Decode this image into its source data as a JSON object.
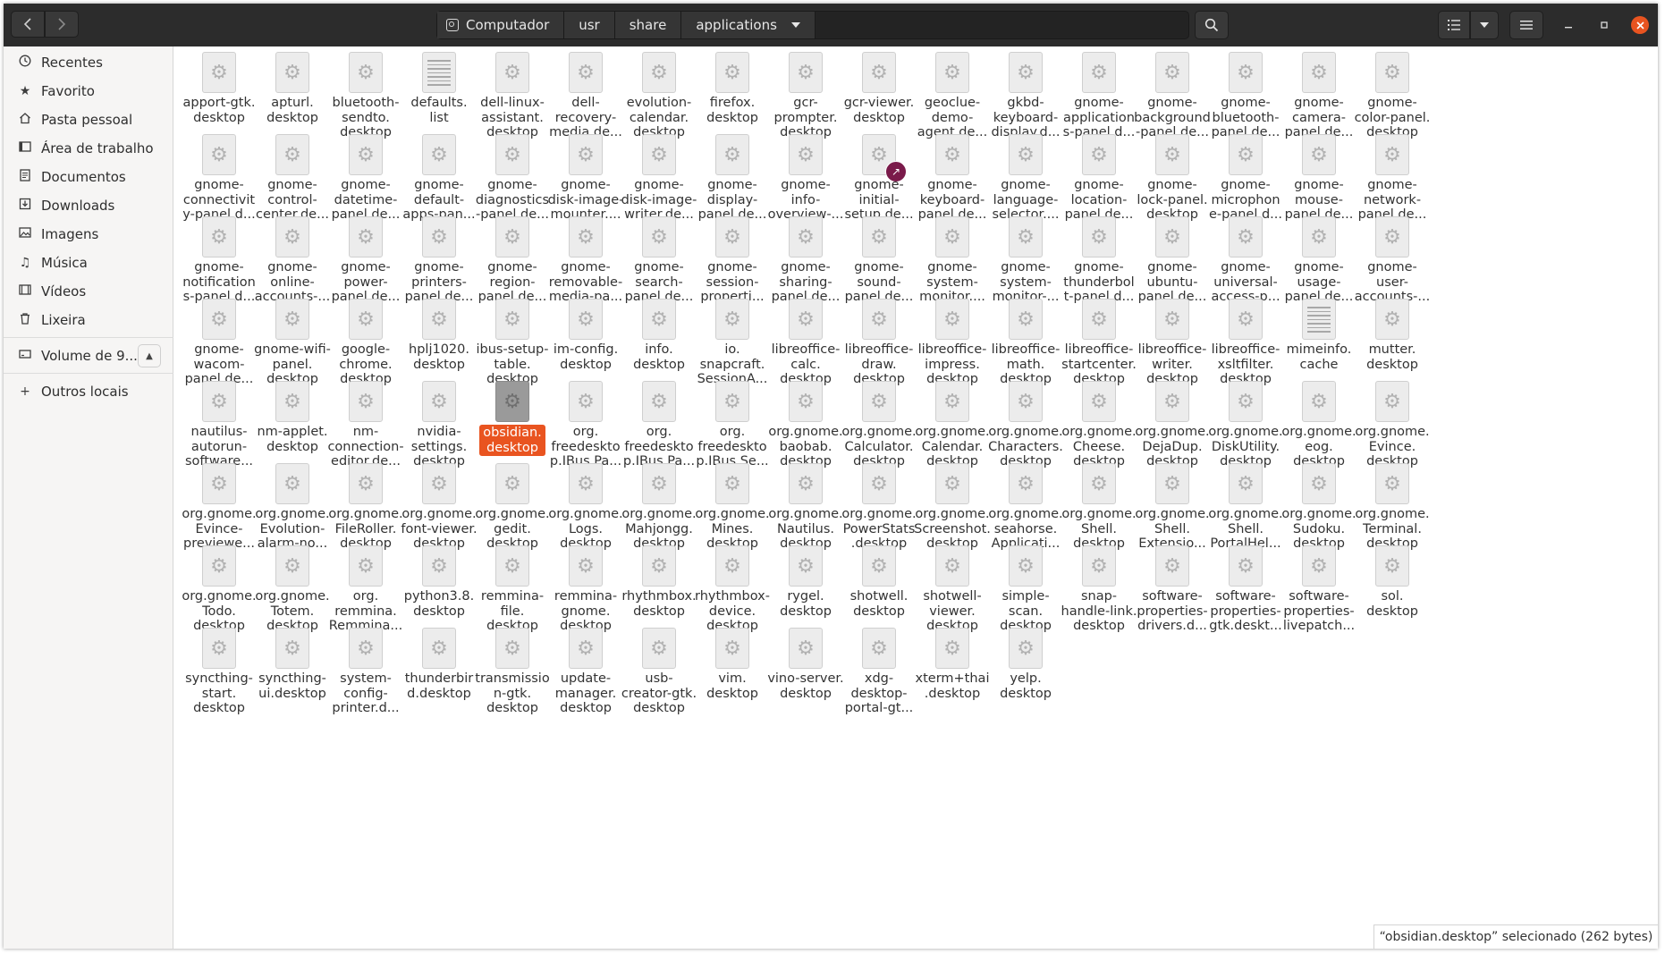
{
  "window": {
    "path": [
      "Computador",
      "usr",
      "share",
      "applications"
    ]
  },
  "sidebar": {
    "items": [
      {
        "label": "Recentes",
        "icon": "clock-icon"
      },
      {
        "label": "Favorito",
        "icon": "star-icon"
      },
      {
        "label": "Pasta pessoal",
        "icon": "home-icon"
      },
      {
        "label": "Área de trabalho",
        "icon": "desktop-icon"
      },
      {
        "label": "Documentos",
        "icon": "document-icon"
      },
      {
        "label": "Downloads",
        "icon": "download-icon"
      },
      {
        "label": "Imagens",
        "icon": "image-icon"
      },
      {
        "label": "Música",
        "icon": "music-icon"
      },
      {
        "label": "Vídeos",
        "icon": "video-icon"
      },
      {
        "label": "Lixeira",
        "icon": "trash-icon"
      }
    ],
    "volume": {
      "label": "Volume de 9...",
      "icon": "drive-icon"
    },
    "other": {
      "label": "Outros locais",
      "icon": "plus-icon"
    }
  },
  "files": [
    {
      "name": "apport-gtk.\ndesktop"
    },
    {
      "name": "apturl.\ndesktop"
    },
    {
      "name": "bluetooth-\nsendto.\ndesktop"
    },
    {
      "name": "defaults.\nlist",
      "kind": "text"
    },
    {
      "name": "dell-linux-\nassistant.\ndesktop"
    },
    {
      "name": "dell-\nrecovery-\nmedia.de..."
    },
    {
      "name": "evolution-\ncalendar.\ndesktop"
    },
    {
      "name": "firefox.\ndesktop"
    },
    {
      "name": "gcr-\nprompter.\ndesktop"
    },
    {
      "name": "gcr-viewer.\ndesktop"
    },
    {
      "name": "geoclue-\ndemo-\nagent.de..."
    },
    {
      "name": "gkbd-\nkeyboard-\ndisplay.d..."
    },
    {
      "name": "gnome-\napplication\ns-panel.d..."
    },
    {
      "name": "gnome-\nbackground\n-panel.de..."
    },
    {
      "name": "gnome-\nbluetooth-\npanel.de..."
    },
    {
      "name": "gnome-\ncamera-\npanel.de..."
    },
    {
      "name": "gnome-\ncolor-panel.\ndesktop"
    },
    {
      "name": "gnome-\nconnectivit\ny-panel.d..."
    },
    {
      "name": "gnome-\ncontrol-\ncenter.de..."
    },
    {
      "name": "gnome-\ndatetime-\npanel.de..."
    },
    {
      "name": "gnome-\ndefault-\napps-pan..."
    },
    {
      "name": "gnome-\ndiagnostics\n-panel.de..."
    },
    {
      "name": "gnome-\ndisk-image-\nmounter...."
    },
    {
      "name": "gnome-\ndisk-image-\nwriter.de..."
    },
    {
      "name": "gnome-\ndisplay-\npanel.de..."
    },
    {
      "name": "gnome-\ninfo-\noverview-..."
    },
    {
      "name": "gnome-\ninitial-\nsetup.de...",
      "link": true
    },
    {
      "name": "gnome-\nkeyboard-\npanel.de..."
    },
    {
      "name": "gnome-\nlanguage-\nselector...."
    },
    {
      "name": "gnome-\nlocation-\npanel.de..."
    },
    {
      "name": "gnome-\nlock-panel.\ndesktop"
    },
    {
      "name": "gnome-\nmicrophon\ne-panel.d..."
    },
    {
      "name": "gnome-\nmouse-\npanel.de..."
    },
    {
      "name": "gnome-\nnetwork-\npanel.de..."
    },
    {
      "name": "gnome-\nnotification\ns-panel.d..."
    },
    {
      "name": "gnome-\nonline-\naccounts-..."
    },
    {
      "name": "gnome-\npower-\npanel.de..."
    },
    {
      "name": "gnome-\nprinters-\npanel.de..."
    },
    {
      "name": "gnome-\nregion-\npanel.de..."
    },
    {
      "name": "gnome-\nremovable-\nmedia-pa..."
    },
    {
      "name": "gnome-\nsearch-\npanel.de..."
    },
    {
      "name": "gnome-\nsession-\nproperti..."
    },
    {
      "name": "gnome-\nsharing-\npanel.de..."
    },
    {
      "name": "gnome-\nsound-\npanel.de..."
    },
    {
      "name": "gnome-\nsystem-\nmonitor...."
    },
    {
      "name": "gnome-\nsystem-\nmonitor-..."
    },
    {
      "name": "gnome-\nthunderbol\nt-panel.d..."
    },
    {
      "name": "gnome-\nubuntu-\npanel.de..."
    },
    {
      "name": "gnome-\nuniversal-\naccess-p..."
    },
    {
      "name": "gnome-\nusage-\npanel.de..."
    },
    {
      "name": "gnome-\nuser-\naccounts-..."
    },
    {
      "name": "gnome-\nwacom-\npanel.de..."
    },
    {
      "name": "gnome-wifi-\npanel.\ndesktop"
    },
    {
      "name": "google-\nchrome.\ndesktop"
    },
    {
      "name": "hplj1020.\ndesktop"
    },
    {
      "name": "ibus-setup-\ntable.\ndesktop"
    },
    {
      "name": "im-config.\ndesktop"
    },
    {
      "name": "info.\ndesktop"
    },
    {
      "name": "io.\nsnapcraft.\nSessionA..."
    },
    {
      "name": "libreoffice-\ncalc.\ndesktop"
    },
    {
      "name": "libreoffice-\ndraw.\ndesktop"
    },
    {
      "name": "libreoffice-\nimpress.\ndesktop"
    },
    {
      "name": "libreoffice-\nmath.\ndesktop"
    },
    {
      "name": "libreoffice-\nstartcenter.\ndesktop"
    },
    {
      "name": "libreoffice-\nwriter.\ndesktop"
    },
    {
      "name": "libreoffice-\nxsltfilter.\ndesktop"
    },
    {
      "name": "mimeinfo.\ncache",
      "kind": "text"
    },
    {
      "name": "mutter.\ndesktop"
    },
    {
      "name": "nautilus-\nautorun-\nsoftware..."
    },
    {
      "name": "nm-applet.\ndesktop"
    },
    {
      "name": "nm-\nconnection-\neditor.de..."
    },
    {
      "name": "nvidia-\nsettings.\ndesktop"
    },
    {
      "name": "obsidian.\ndesktop",
      "selected": true
    },
    {
      "name": "org.\nfreedeskto\np.IBus.Pa..."
    },
    {
      "name": "org.\nfreedeskto\np.IBus.Pa..."
    },
    {
      "name": "org.\nfreedeskto\np.IBus.Se..."
    },
    {
      "name": "org.gnome.\nbaobab.\ndesktop"
    },
    {
      "name": "org.gnome.\nCalculator.\ndesktop"
    },
    {
      "name": "org.gnome.\nCalendar.\ndesktop"
    },
    {
      "name": "org.gnome.\nCharacters.\ndesktop"
    },
    {
      "name": "org.gnome.\nCheese.\ndesktop"
    },
    {
      "name": "org.gnome.\nDejaDup.\ndesktop"
    },
    {
      "name": "org.gnome.\nDiskUtility.\ndesktop"
    },
    {
      "name": "org.gnome.\neog.\ndesktop"
    },
    {
      "name": "org.gnome.\nEvince.\ndesktop"
    },
    {
      "name": "org.gnome.\nEvince-\npreviewe..."
    },
    {
      "name": "org.gnome.\nEvolution-\nalarm-no..."
    },
    {
      "name": "org.gnome.\nFileRoller.\ndesktop"
    },
    {
      "name": "org.gnome.\nfont-viewer.\ndesktop"
    },
    {
      "name": "org.gnome.\ngedit.\ndesktop"
    },
    {
      "name": "org.gnome.\nLogs.\ndesktop"
    },
    {
      "name": "org.gnome.\nMahjongg.\ndesktop"
    },
    {
      "name": "org.gnome.\nMines.\ndesktop"
    },
    {
      "name": "org.gnome.\nNautilus.\ndesktop"
    },
    {
      "name": "org.gnome.\nPowerStats\n.desktop"
    },
    {
      "name": "org.gnome.\nScreenshot.\ndesktop"
    },
    {
      "name": "org.gnome.\nseahorse.\nApplicati..."
    },
    {
      "name": "org.gnome.\nShell.\ndesktop"
    },
    {
      "name": "org.gnome.\nShell.\nExtensio..."
    },
    {
      "name": "org.gnome.\nShell.\nPortalHel..."
    },
    {
      "name": "org.gnome.\nSudoku.\ndesktop"
    },
    {
      "name": "org.gnome.\nTerminal.\ndesktop"
    },
    {
      "name": "org.gnome.\nTodo.\ndesktop"
    },
    {
      "name": "org.gnome.\nTotem.\ndesktop"
    },
    {
      "name": "org.\nremmina.\nRemmina..."
    },
    {
      "name": "python3.8.\ndesktop"
    },
    {
      "name": "remmina-\nfile.\ndesktop"
    },
    {
      "name": "remmina-\ngnome.\ndesktop"
    },
    {
      "name": "rhythmbox.\ndesktop"
    },
    {
      "name": "rhythmbox-\ndevice.\ndesktop"
    },
    {
      "name": "rygel.\ndesktop"
    },
    {
      "name": "shotwell.\ndesktop"
    },
    {
      "name": "shotwell-\nviewer.\ndesktop"
    },
    {
      "name": "simple-\nscan.\ndesktop"
    },
    {
      "name": "snap-\nhandle-link.\ndesktop"
    },
    {
      "name": "software-\nproperties-\ndrivers.d..."
    },
    {
      "name": "software-\nproperties-\ngtk.deskt..."
    },
    {
      "name": "software-\nproperties-\nlivepatch..."
    },
    {
      "name": "sol.\ndesktop"
    },
    {
      "name": "syncthing-\nstart.\ndesktop"
    },
    {
      "name": "syncthing-\nui.desktop"
    },
    {
      "name": "system-\nconfig-\nprinter.d..."
    },
    {
      "name": "thunderbir\nd.desktop"
    },
    {
      "name": "transmissio\nn-gtk.\ndesktop"
    },
    {
      "name": "update-\nmanager.\ndesktop"
    },
    {
      "name": "usb-\ncreator-gtk.\ndesktop"
    },
    {
      "name": "vim.\ndesktop"
    },
    {
      "name": "vino-server.\ndesktop"
    },
    {
      "name": "xdg-\ndesktop-\nportal-gt..."
    },
    {
      "name": "xterm+thai\n.desktop"
    },
    {
      "name": "yelp.\ndesktop"
    }
  ],
  "status": {
    "text": "“obsidian.desktop” selecionado  (262 bytes)"
  }
}
